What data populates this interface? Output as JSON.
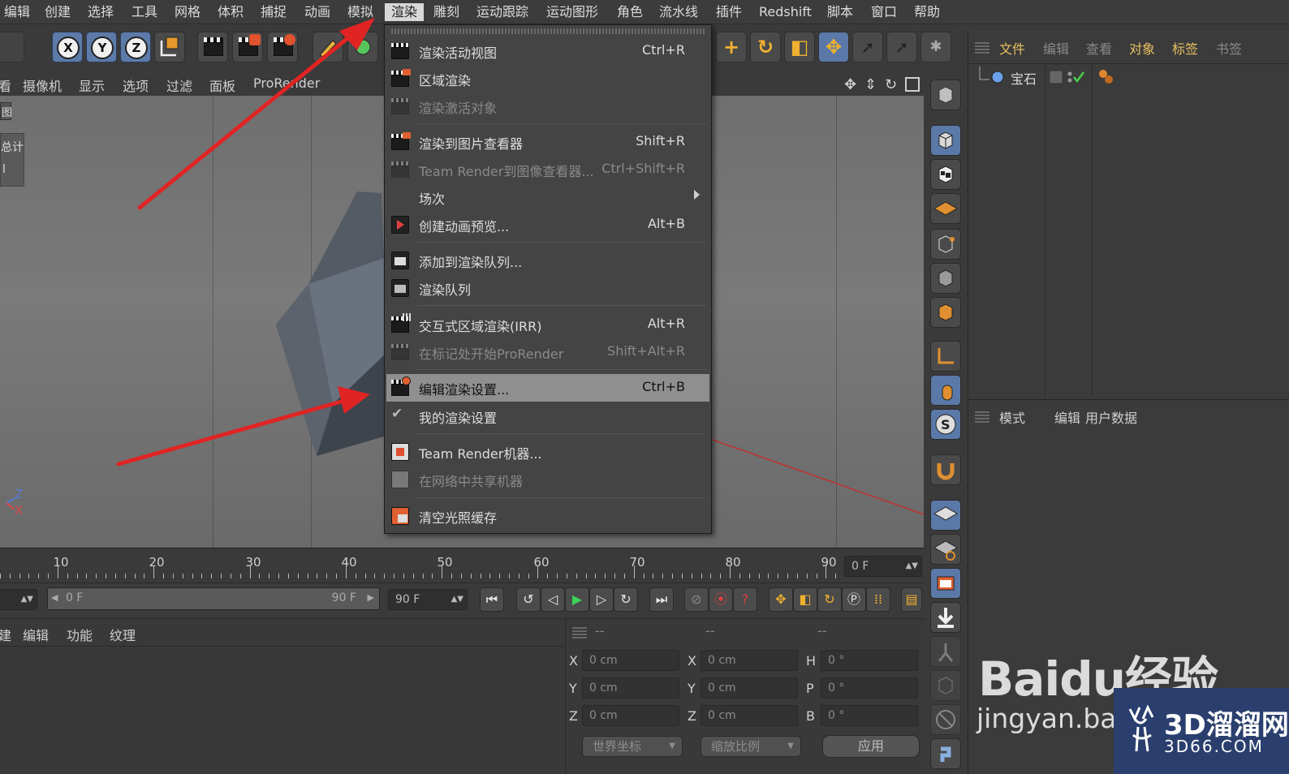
{
  "menubar": {
    "items": [
      "编辑",
      "创建",
      "选择",
      "工具",
      "网格",
      "体积",
      "捕捉",
      "动画",
      "模拟",
      "渲染",
      "雕刻",
      "运动跟踪",
      "运动图形",
      "角色",
      "流水线",
      "插件",
      "Redshift",
      "脚本",
      "窗口",
      "帮助"
    ],
    "active": "渲染"
  },
  "toolbar": {
    "axes": [
      "X",
      "Y",
      "Z"
    ]
  },
  "viewport_menu": [
    "看",
    "摄像机",
    "显示",
    "选项",
    "过滤",
    "面板",
    "ProRender"
  ],
  "viewport_hud": {
    "left_labels": [
      "图",
      "总计",
      "l"
    ],
    "axis_labels": [
      "Z",
      "X"
    ]
  },
  "render_menu": {
    "items": [
      {
        "label": "渲染活动视图",
        "shortcut": "Ctrl+R",
        "enabled": true
      },
      {
        "label": "区域渲染",
        "shortcut": "",
        "enabled": true
      },
      {
        "label": "渲染激活对象",
        "shortcut": "",
        "enabled": false
      },
      {
        "label": "渲染到图片查看器",
        "shortcut": "Shift+R",
        "enabled": true
      },
      {
        "label": "Team Render到图像查看器...",
        "shortcut": "Ctrl+Shift+R",
        "enabled": false
      },
      {
        "label": "场次",
        "shortcut": "",
        "enabled": true,
        "submenu": true
      },
      {
        "label": "创建动画预览...",
        "shortcut": "Alt+B",
        "enabled": true
      },
      {
        "label": "添加到渲染队列...",
        "shortcut": "",
        "enabled": true
      },
      {
        "label": "渲染队列",
        "shortcut": "",
        "enabled": true
      },
      {
        "label": "交互式区域渲染(IRR)",
        "shortcut": "Alt+R",
        "enabled": true
      },
      {
        "label": "在标记处开始ProRender",
        "shortcut": "Shift+Alt+R",
        "enabled": false
      },
      {
        "label": "编辑渲染设置...",
        "shortcut": "Ctrl+B",
        "enabled": true,
        "highlighted": true
      },
      {
        "label": "我的渲染设置",
        "shortcut": "",
        "enabled": true,
        "checked": true
      },
      {
        "label": "Team Render机器...",
        "shortcut": "",
        "enabled": true
      },
      {
        "label": "在网络中共享机器",
        "shortcut": "",
        "enabled": false
      },
      {
        "label": "清空光照缓存",
        "shortcut": "",
        "enabled": true
      }
    ]
  },
  "object_manager": {
    "menu": [
      "文件",
      "编辑",
      "查看",
      "对象",
      "标签",
      "书签"
    ],
    "objects": [
      {
        "name": "宝石"
      }
    ]
  },
  "attribute_manager": {
    "menu": [
      "模式",
      "编辑",
      "用户数据"
    ]
  },
  "timeline": {
    "ticks": [
      "10",
      "20",
      "30",
      "40",
      "50",
      "60",
      "70",
      "80",
      "90"
    ],
    "current_frame": "0 F"
  },
  "transport": {
    "range_start": "0 F",
    "range_end": "90 F",
    "end_field": "90 F"
  },
  "material_panel": {
    "menu": [
      "建",
      "编辑",
      "功能",
      "纹理"
    ]
  },
  "coordinates": {
    "headers": [
      "--",
      "--",
      "--"
    ],
    "position": [
      {
        "axis": "X",
        "value": "0 cm"
      },
      {
        "axis": "Y",
        "value": "0 cm"
      },
      {
        "axis": "Z",
        "value": "0 cm"
      }
    ],
    "size": [
      {
        "axis": "X",
        "value": "0 cm"
      },
      {
        "axis": "Y",
        "value": "0 cm"
      },
      {
        "axis": "Z",
        "value": "0 cm"
      }
    ],
    "rotation": [
      {
        "axis": "H",
        "value": "0 °"
      },
      {
        "axis": "P",
        "value": "0 °"
      },
      {
        "axis": "B",
        "value": "0 °"
      }
    ],
    "mode_dropdown": "世界坐标",
    "scale_dropdown": "缩放比例",
    "apply_label": "应用"
  },
  "watermarks": {
    "baidu": "Baidu经验",
    "baidu_url": "jingyan.baidu",
    "brand_cn": "3D溜溜网",
    "brand_url": "3D66.COM"
  },
  "colors": {
    "accent_blue": "#5d7aa8",
    "highlight": "#8f8f8f",
    "arrow_red": "#e02424",
    "brand_blue": "#2a3f6e"
  }
}
